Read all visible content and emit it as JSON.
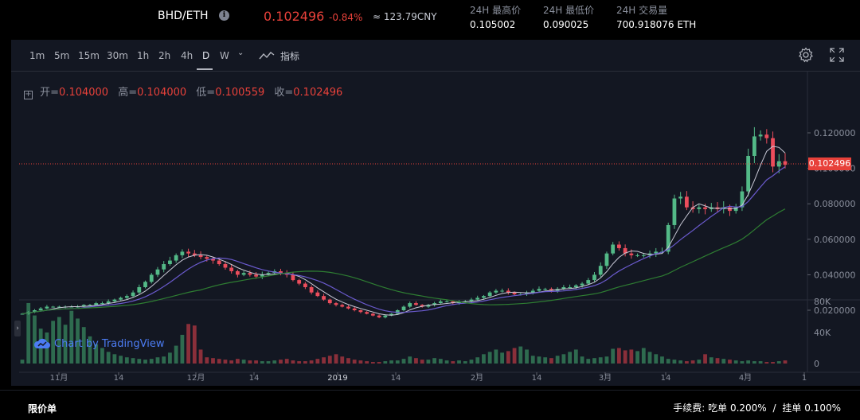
{
  "ticker": {
    "pair": "BHD/ETH",
    "price": "0.102496",
    "change": "-0.84%",
    "cny": "≈ 123.79CNY",
    "stats": [
      {
        "label": "24H 最高价",
        "value": "0.105002"
      },
      {
        "label": "24H 最低价",
        "value": "0.090025"
      },
      {
        "label": "24H 交易量",
        "value": "700.918076 ETH"
      }
    ]
  },
  "toolbar": {
    "timeframes": [
      "1m",
      "5m",
      "15m",
      "30m",
      "1h",
      "2h",
      "4h",
      "D",
      "W"
    ],
    "active": "D",
    "indicators_label": "指标"
  },
  "ohlc": {
    "open_label": "开=",
    "open": "0.104000",
    "high_label": "高=",
    "high": "0.104000",
    "low_label": "低=",
    "low": "0.100559",
    "close_label": "收=",
    "close": "0.102496"
  },
  "watermark": "Chart by TradingView",
  "colors": {
    "up": "#53b987",
    "down": "#eb4d5c",
    "accent_red": "#e8413a",
    "ma_fast": "#c9c9d6",
    "ma_mid": "#6a5acd",
    "ma_slow": "#2e7d32"
  },
  "bottom": {
    "order_type": "限价单",
    "fee_label": "手续费:",
    "taker": "吃单 0.200%",
    "separator": "/",
    "maker": "挂单 0.100%"
  },
  "chart_data": {
    "type": "candlestick",
    "last_price": "0.102496",
    "y_ticks": [
      "0.120000",
      "0.100000",
      "0.080000",
      "0.060000",
      "0.040000",
      "0.020000"
    ],
    "y_tick_values": [
      0.12,
      0.1,
      0.08,
      0.06,
      0.04,
      0.02
    ],
    "volume_ticks": [
      "80K",
      "40K",
      "0"
    ],
    "volume_tick_values": [
      80000,
      40000,
      0
    ],
    "x_ticks": [
      "11月",
      "14",
      "12月",
      "14",
      "2019",
      "14",
      "2月",
      "14",
      "3月",
      "14",
      "4月",
      "1"
    ],
    "close_path": [
      0.018,
      0.019,
      0.02,
      0.021,
      0.022,
      0.022,
      0.022,
      0.022,
      0.022,
      0.022,
      0.023,
      0.023,
      0.024,
      0.024,
      0.025,
      0.026,
      0.027,
      0.028,
      0.03,
      0.033,
      0.036,
      0.04,
      0.043,
      0.046,
      0.048,
      0.051,
      0.053,
      0.052,
      0.051,
      0.05,
      0.049,
      0.048,
      0.046,
      0.044,
      0.042,
      0.04,
      0.041,
      0.04,
      0.039,
      0.04,
      0.041,
      0.042,
      0.041,
      0.04,
      0.037,
      0.035,
      0.033,
      0.03,
      0.028,
      0.026,
      0.024,
      0.023,
      0.022,
      0.021,
      0.02,
      0.019,
      0.018,
      0.017,
      0.016,
      0.017,
      0.018,
      0.02,
      0.022,
      0.024,
      0.023,
      0.022,
      0.023,
      0.024,
      0.025,
      0.025,
      0.024,
      0.025,
      0.025,
      0.026,
      0.027,
      0.028,
      0.03,
      0.031,
      0.031,
      0.03,
      0.029,
      0.029,
      0.03,
      0.031,
      0.032,
      0.032,
      0.031,
      0.032,
      0.033,
      0.033,
      0.034,
      0.035,
      0.037,
      0.04,
      0.045,
      0.052,
      0.057,
      0.055,
      0.052,
      0.051,
      0.051,
      0.051,
      0.052,
      0.053,
      0.053,
      0.068,
      0.083,
      0.084,
      0.078,
      0.077,
      0.078,
      0.077,
      0.078,
      0.077,
      0.078,
      0.076,
      0.078,
      0.087,
      0.107,
      0.118,
      0.119,
      0.117,
      0.101,
      0.104,
      0.102
    ],
    "volume_path": [
      5,
      78,
      62,
      45,
      40,
      55,
      60,
      50,
      68,
      58,
      47,
      35,
      25,
      20,
      15,
      12,
      10,
      8,
      7,
      6,
      5,
      6,
      8,
      9,
      14,
      23,
      37,
      51,
      49,
      18,
      8,
      7,
      6,
      5,
      4,
      6,
      5,
      4,
      4,
      3,
      3,
      4,
      5,
      6,
      4,
      3,
      3,
      4,
      6,
      8,
      10,
      12,
      9,
      7,
      5,
      4,
      3,
      2,
      2,
      3,
      4,
      4,
      6,
      9,
      7,
      5,
      5,
      7,
      6,
      4,
      3,
      4,
      3,
      5,
      8,
      12,
      15,
      18,
      14,
      16,
      20,
      22,
      18,
      10,
      9,
      8,
      7,
      10,
      12,
      15,
      18,
      9,
      6,
      7,
      8,
      9,
      19,
      20,
      17,
      18,
      16,
      20,
      15,
      12,
      9,
      6,
      5,
      4,
      3,
      4,
      5,
      12,
      8,
      7,
      6,
      5,
      4,
      3,
      4,
      3,
      3,
      2,
      2,
      3,
      4,
      3,
      2,
      2
    ]
  }
}
